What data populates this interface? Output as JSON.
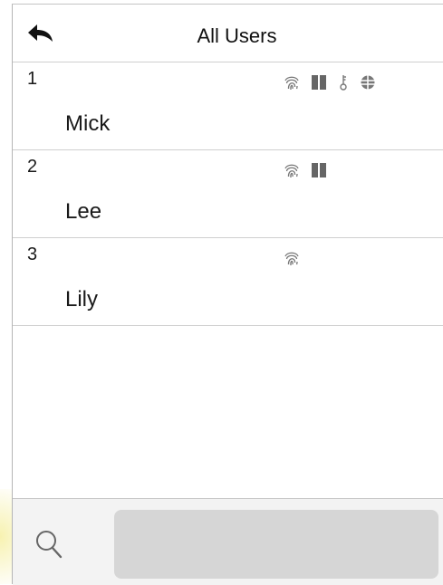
{
  "header": {
    "title": "All Users",
    "back_icon": "back-arrow-icon"
  },
  "users": [
    {
      "id": "1",
      "name": "Mick",
      "credentials": [
        "fingerprint-icon",
        "card-icon",
        "password-icon",
        "face-icon"
      ]
    },
    {
      "id": "2",
      "name": "Lee",
      "credentials": [
        "fingerprint-icon",
        "card-icon"
      ]
    },
    {
      "id": "3",
      "name": "Lily",
      "credentials": [
        "fingerprint-icon"
      ]
    }
  ],
  "footer": {
    "search_icon": "search-icon",
    "search_value": "",
    "search_placeholder": ""
  },
  "colors": {
    "text": "#1a1a1a",
    "icon": "#777777",
    "divider": "#cfcfcf",
    "footer_bg": "#f3f3f3",
    "input_bg": "#d6d6d6"
  }
}
